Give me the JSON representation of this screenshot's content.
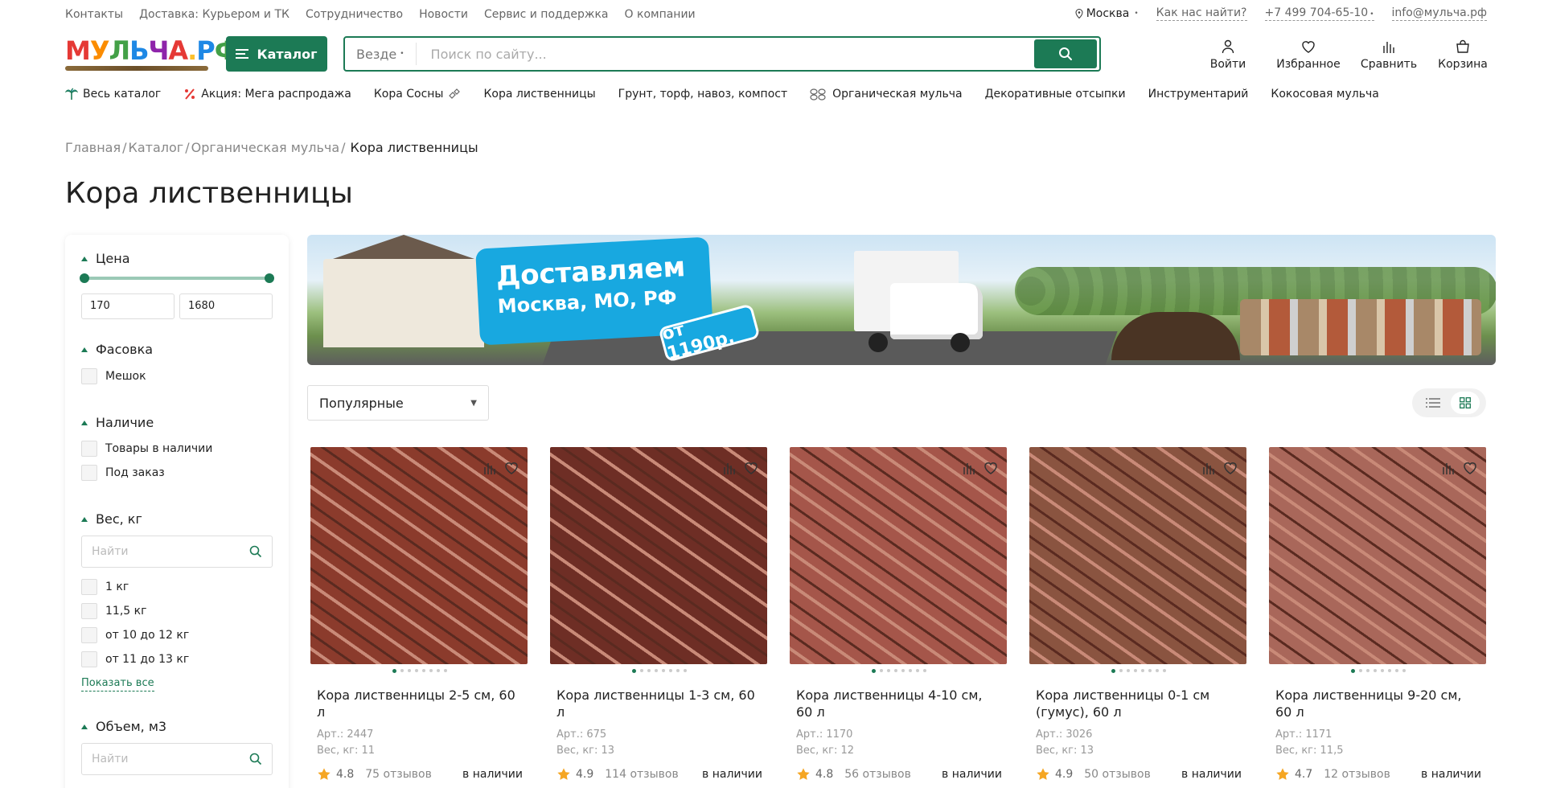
{
  "topbar": {
    "links": [
      "Контакты",
      "Доставка: Курьером и ТК",
      "Сотрудничество",
      "Новости",
      "Сервис и поддержка",
      "О компании"
    ],
    "city": "Москва",
    "find_us": "Как нас найти?",
    "phone": "+7 499 704-65-10",
    "email": "info@мульча.рф"
  },
  "header": {
    "logo_text": "МУЛЬЧА.РФ",
    "catalog_label": "Каталог",
    "search_scope": "Везде",
    "search_placeholder": "Поиск по сайту...",
    "actions": [
      "Войти",
      "Избранное",
      "Сравнить",
      "Корзина"
    ]
  },
  "catnav": [
    "Весь каталог",
    "Акция: Мега распродажа",
    "Кора Сосны",
    "Кора лиственницы",
    "Грунт, торф, навоз, компост",
    "Органическая мульча",
    "Декоративные отсыпки",
    "Инструментарий",
    "Кокосовая мульча"
  ],
  "breadcrumbs": {
    "items": [
      "Главная",
      "/",
      "Каталог",
      "/",
      "Органическая мульча",
      "/"
    ],
    "current": "Кора лиственницы"
  },
  "page_title": "Кора лиственницы",
  "filters": {
    "price_title": "Цена",
    "price_min": "170",
    "price_max": "1680",
    "package_title": "Фасовка",
    "package_options": [
      "Мешок"
    ],
    "availability_title": "Наличие",
    "availability_options": [
      "Товары в наличии",
      "Под заказ"
    ],
    "weight_title": "Вес, кг",
    "weight_search_placeholder": "Найти",
    "weight_options": [
      "1 кг",
      "11,5 кг",
      "от 10 до 12 кг",
      "от 11 до 13 кг"
    ],
    "show_all": "Показать все",
    "volume_title": "Объем, м3",
    "volume_search_placeholder": "Найти"
  },
  "banner": {
    "line1": "Доставляем",
    "line2": "Москва, МО, РФ",
    "price": "от 1190р."
  },
  "sort": {
    "selected": "Популярные"
  },
  "products": [
    {
      "name": "Кора лиственницы 2-5 см, 60 л",
      "art": "Арт.: 2447",
      "weight": "Вес, кг: 11",
      "rating": "4.8",
      "reviews": "75 отзывов",
      "stock": "в наличии",
      "color": "#8b3b2c"
    },
    {
      "name": "Кора лиственницы 1-3 см, 60 л",
      "art": "Арт.: 675",
      "weight": "Вес, кг: 13",
      "rating": "4.9",
      "reviews": "114 отзывов",
      "stock": "в наличии",
      "color": "#6e2e25"
    },
    {
      "name": "Кора лиственницы 4-10 см, 60 л",
      "art": "Арт.: 1170",
      "weight": "Вес, кг: 12",
      "rating": "4.8",
      "reviews": "56 отзывов",
      "stock": "в наличии",
      "color": "#a5564a"
    },
    {
      "name": "Кора лиственницы 0-1 см (гумус), 60 л",
      "art": "Арт.: 3026",
      "weight": "Вес, кг: 13",
      "rating": "4.9",
      "reviews": "50 отзывов",
      "stock": "в наличии",
      "color": "#8a5440"
    },
    {
      "name": "Кора лиственницы 9-20 см, 60 л",
      "art": "Арт.: 1171",
      "weight": "Вес, кг: 11,5",
      "rating": "4.7",
      "reviews": "12 отзывов",
      "stock": "в наличии",
      "color": "#a9675a"
    }
  ],
  "colors": {
    "brand": "#1c7a55",
    "star": "#f5a623"
  }
}
